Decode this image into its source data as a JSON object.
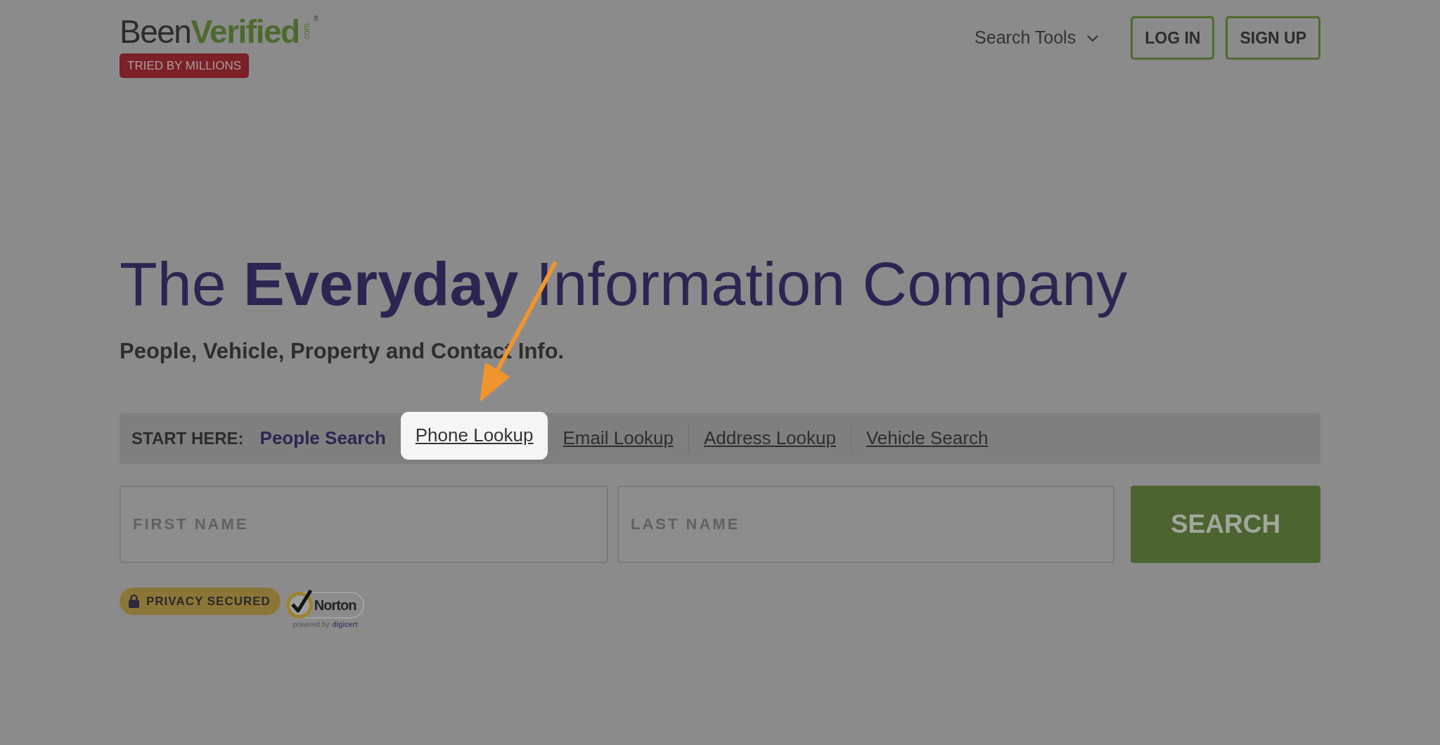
{
  "header": {
    "logo": {
      "wordmark": "Been**Verified**",
      "domain": ".com",
      "trademark": "®",
      "tagline": "TRIED BY MILLIONS"
    },
    "menu": {
      "label": "Search Tools",
      "expanded": false
    },
    "buttons": [
      "LOG IN",
      "SIGN UP"
    ]
  },
  "hero": {
    "headline": "The **Everyday** Information Company",
    "subheading": "People, Vehicle, Property and Contact Info."
  },
  "search": {
    "label": "START HERE:",
    "tabs": [
      {
        "label": "People Search",
        "selected": true,
        "highlighted": false
      },
      {
        "label": "Phone Lookup",
        "selected": false,
        "highlighted": true
      },
      {
        "label": "Email Lookup",
        "selected": false,
        "highlighted": false
      },
      {
        "label": "Address Lookup",
        "selected": false,
        "highlighted": false
      },
      {
        "label": "Vehicle Search",
        "selected": false,
        "highlighted": false
      }
    ],
    "fields": [
      {
        "placeholder": "FIRST NAME"
      },
      {
        "placeholder": "LAST NAME"
      }
    ],
    "button": "SEARCH"
  },
  "trust": {
    "privacy": "PRIVACY SECURED",
    "seal": {
      "brand": "Norton",
      "powered_by": "powered by",
      "vendor": "digicert"
    }
  },
  "annotation": {
    "kind": "arrow"
  }
}
